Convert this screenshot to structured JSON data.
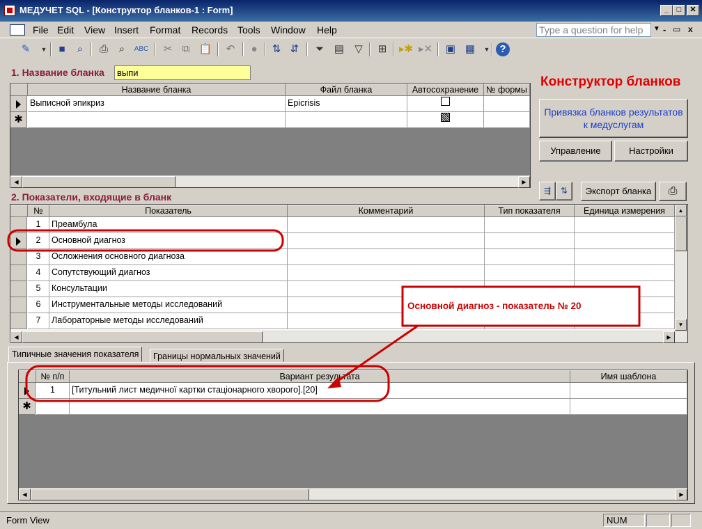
{
  "window": {
    "title": "МЕДУЧЕТ SQL - [Конструктор бланков-1 : Form]",
    "min_icon": "minimize-icon",
    "max_icon": "maximize-icon",
    "close_icon": "close-icon"
  },
  "menu": {
    "items": [
      "File",
      "Edit",
      "View",
      "Insert",
      "Format",
      "Records",
      "Tools",
      "Window",
      "Help"
    ],
    "question_placeholder": "Type a question for help"
  },
  "section1": {
    "label": "1. Название бланка",
    "filter_value": "выпи",
    "columns": [
      "Название бланка",
      "Файл бланка",
      "Автосохранение",
      "№ формы"
    ],
    "rows": [
      {
        "name": "Выписной эпикриз",
        "file": "Epicrisis"
      }
    ]
  },
  "right_panel": {
    "title": "Конструктор бланков",
    "bind_button": "Привязка бланков результатов к медуслугам",
    "manage_button": "Управление",
    "settings_button": "Настройки",
    "export_button": "Экспорт бланка"
  },
  "section2": {
    "label": "2. Показатели, входящие в бланк",
    "columns": [
      "№",
      "Показатель",
      "Комментарий",
      "Тип показателя",
      "Единица измерения"
    ],
    "rows": [
      {
        "num": "1",
        "name": "Преамбула"
      },
      {
        "num": "2",
        "name": "Основной диагноз"
      },
      {
        "num": "3",
        "name": "Осложнения основного диагноза"
      },
      {
        "num": "4",
        "name": "Сопутствующий диагноз"
      },
      {
        "num": "5",
        "name": "Консультации"
      },
      {
        "num": "6",
        "name": "Инструментальные методы исследований"
      },
      {
        "num": "7",
        "name": "Лабораторные методы исследований"
      }
    ]
  },
  "callout": {
    "text": "Основной диагноз - показатель № 20",
    "color": "#cc0000"
  },
  "tabs": [
    "Типичные значения показателя",
    "Границы нормальных значений"
  ],
  "section3": {
    "columns": [
      "№ п/п",
      "Вариант результата",
      "Имя шаблона"
    ],
    "rows": [
      {
        "num": "1",
        "value": "[Титульний лист медичної картки стаціонарного хворого].[20]"
      }
    ]
  },
  "status": {
    "mode": "Form View",
    "num": "NUM"
  }
}
